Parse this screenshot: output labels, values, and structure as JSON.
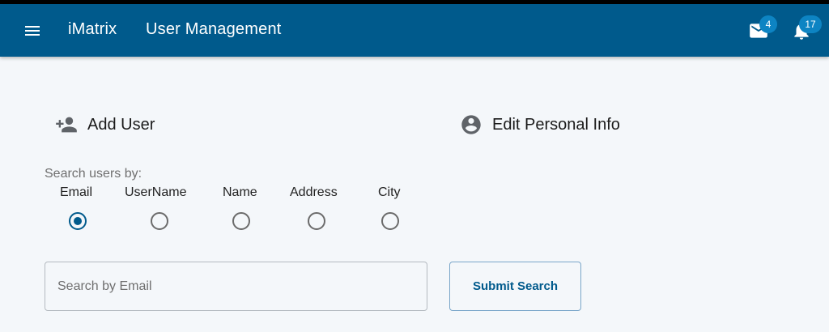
{
  "appbar": {
    "app_title": "iMatrix",
    "page_title": "User Management",
    "menu_icon": "hamburger-menu-icon",
    "mail_icon": "mail-icon",
    "mail_count": "4",
    "notifications_icon": "bell-icon",
    "notifications_count": "17",
    "color": "#005a8c"
  },
  "tabs": {
    "add_user": {
      "label": "Add User",
      "icon": "person-add-icon"
    },
    "edit_info": {
      "label": "Edit Personal Info",
      "icon": "account-circle-icon"
    }
  },
  "search": {
    "prompt": "Search users by:",
    "options": [
      "Email",
      "UserName",
      "Name",
      "Address",
      "City"
    ],
    "selected": "Email",
    "placeholder": "Search by Email",
    "value": "",
    "submit_label": "Submit Search"
  }
}
